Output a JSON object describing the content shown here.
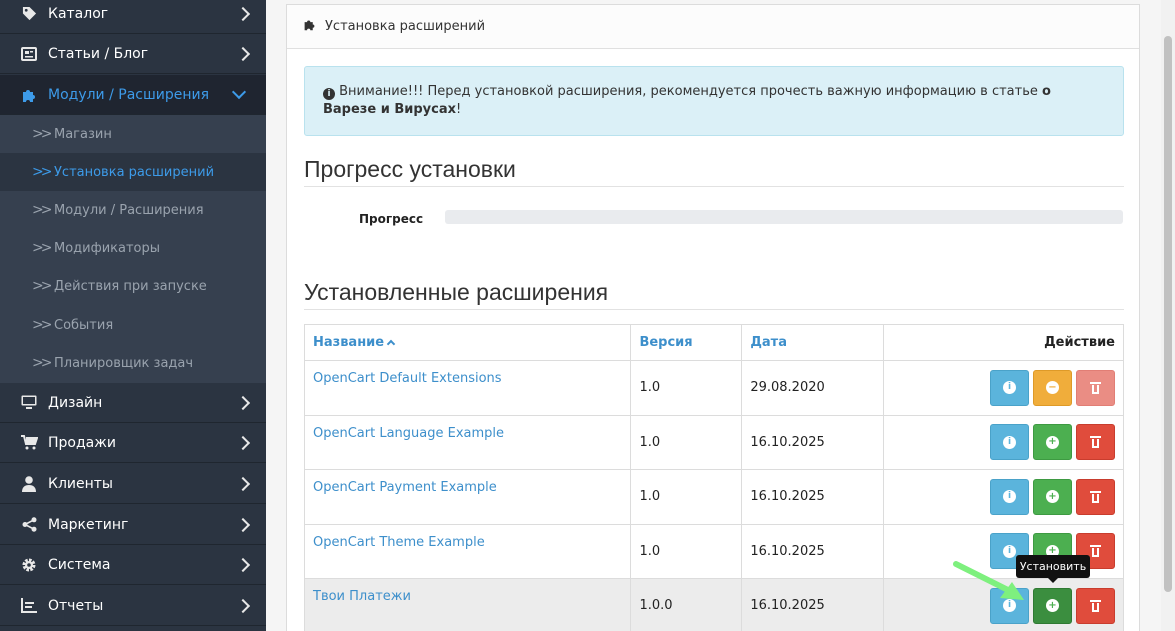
{
  "sidebar": {
    "items": [
      {
        "label": "Каталог",
        "icon": "tag-icon"
      },
      {
        "label": "Статьи / Блог",
        "icon": "newspaper-icon"
      },
      {
        "label": "Модули / Расширения",
        "icon": "puzzle-icon"
      },
      {
        "label": "Дизайн",
        "icon": "monitor-icon"
      },
      {
        "label": "Продажи",
        "icon": "cart-icon"
      },
      {
        "label": "Клиенты",
        "icon": "user-icon"
      },
      {
        "label": "Маркетинг",
        "icon": "share-icon"
      },
      {
        "label": "Система",
        "icon": "gear-icon"
      },
      {
        "label": "Отчеты",
        "icon": "report-icon"
      }
    ],
    "submenu": [
      "Магазин",
      "Установка расширений",
      "Модули / Расширения",
      "Модификаторы",
      "Действия при запуске",
      "События",
      "Планировщик задач"
    ]
  },
  "panel": {
    "title": "Установка расширений",
    "alert_text": "Внимание!!! Перед установкой расширения, рекомендуется прочесть важную информацию в статье ",
    "alert_bold": "о Варезе и Вирусах",
    "alert_end": "!"
  },
  "progress": {
    "heading": "Прогресс установки",
    "label": "Прогресс",
    "value": 0
  },
  "installed": {
    "heading": "Установленные расширения",
    "columns": {
      "name": "Название",
      "version": "Версия",
      "date": "Дата",
      "action": "Действие"
    },
    "rows": [
      {
        "name": "OpenCart Default Extensions",
        "version": "1.0",
        "date": "29.08.2020"
      },
      {
        "name": "OpenCart Language Example",
        "version": "1.0",
        "date": "16.10.2025"
      },
      {
        "name": "OpenCart Payment Example",
        "version": "1.0",
        "date": "16.10.2025"
      },
      {
        "name": "OpenCart Theme Example",
        "version": "1.0",
        "date": "16.10.2025"
      },
      {
        "name": "Твои Платежи",
        "version": "1.0.0",
        "date": "16.10.2025"
      }
    ]
  },
  "tooltip": "Установить",
  "colors": {
    "sidebar_bg": "#2b3441",
    "accent": "#3d9be9",
    "info": "#5bb4dc",
    "success": "#4caf50",
    "warning": "#f0ad3b",
    "danger": "#e04c3c",
    "annotation_arrow": "#7ef07e"
  }
}
